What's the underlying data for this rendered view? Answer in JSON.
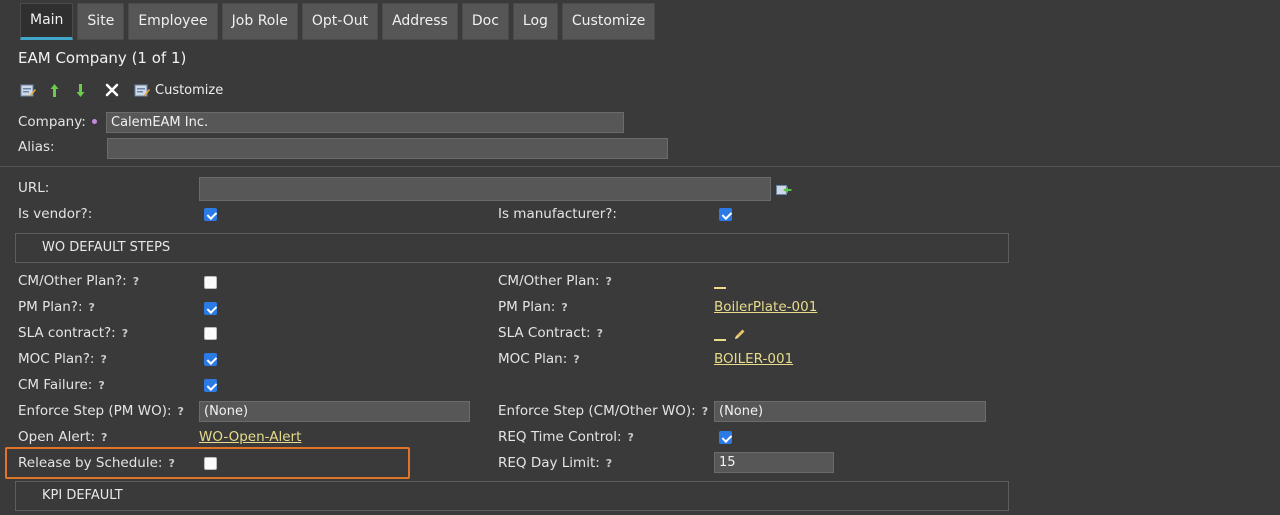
{
  "tabs": [
    "Main",
    "Site",
    "Employee",
    "Job Role",
    "Opt-Out",
    "Address",
    "Doc",
    "Log",
    "Customize"
  ],
  "page_title": "EAM Company (1 of 1)",
  "toolbar": {
    "customize_label": "Customize"
  },
  "fields": {
    "company_label": "Company:",
    "company_value": "CalemEAM Inc.",
    "alias_label": "Alias:",
    "alias_value": "",
    "url_label": "URL:",
    "url_value": "",
    "is_vendor_label": "Is vendor?:",
    "is_vendor": true,
    "is_manufacturer_label": "Is manufacturer?:",
    "is_manufacturer": true
  },
  "wo_section_title": "WO DEFAULT STEPS",
  "wo": {
    "cm_other_plan_q_label": "CM/Other Plan?:",
    "cm_other_plan_q": false,
    "cm_other_plan_label": "CM/Other Plan:",
    "pm_plan_q_label": "PM Plan?:",
    "pm_plan_q": true,
    "pm_plan_label": "PM Plan:",
    "pm_plan_value": "BoilerPlate-001",
    "sla_contract_q_label": "SLA contract?:",
    "sla_contract_q": false,
    "sla_contract_label": "SLA Contract:",
    "moc_plan_q_label": "MOC Plan?:",
    "moc_plan_q": true,
    "moc_plan_label": "MOC Plan:",
    "moc_plan_value": "BOILER-001",
    "cm_failure_label": "CM Failure:",
    "cm_failure": true,
    "enforce_pm_label": "Enforce Step (PM WO):",
    "enforce_pm_value": "(None)",
    "enforce_cm_label": "Enforce Step (CM/Other WO):",
    "enforce_cm_value": "(None)",
    "open_alert_label": "Open Alert:",
    "open_alert_value": "WO-Open-Alert",
    "req_time_control_label": "REQ Time Control:",
    "req_time_control": true,
    "release_by_schedule_label": "Release by Schedule:",
    "release_by_schedule": false,
    "req_day_limit_label": "REQ Day Limit:",
    "req_day_limit_value": "15"
  },
  "kpi_section_title": "KPI DEFAULT",
  "help_glyph": "?",
  "colors": {
    "background": "#3a3a3a",
    "tab": "#565656",
    "tab_active_underline": "#3fa7c9",
    "checkbox_checked": "#2c7be5",
    "link": "#e8dc8c",
    "highlight": "#e0752a",
    "required_dot": "#c58bdc"
  }
}
